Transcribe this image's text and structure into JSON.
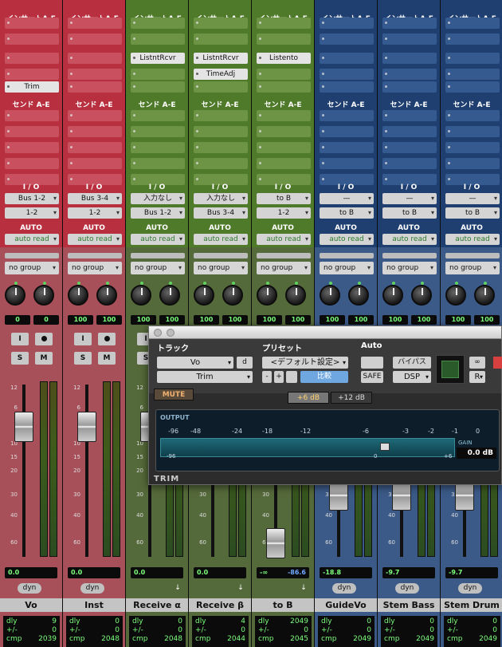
{
  "sections": {
    "insert": "インサートA-E",
    "send": "センド A-E",
    "io": "I / O",
    "auto": "AUTO"
  },
  "strips": [
    {
      "name": "Vo",
      "color": "red",
      "inserts": [
        "",
        "",
        "",
        "",
        "Trim"
      ],
      "io_in": "Bus 1-2",
      "io_out": "1-2",
      "auto": "auto read",
      "group": "no group",
      "pan_l": "0",
      "pan_r": "0",
      "volume": "0.0",
      "peak": "",
      "dyn": "dyn",
      "dly_label": "dly",
      "dly": "9",
      "pm_label": "+/-",
      "pm": "0",
      "cmp_label": "cmp",
      "cmp": "2039"
    },
    {
      "name": "Inst",
      "color": "red",
      "inserts": [
        "",
        "",
        "",
        "",
        ""
      ],
      "io_in": "Bus 3-4",
      "io_out": "1-2",
      "auto": "auto read",
      "group": "no group",
      "pan_l": "100",
      "pan_r": "100",
      "volume": "0.0",
      "peak": "",
      "dyn": "dyn",
      "dly_label": "dly",
      "dly": "0",
      "pm_label": "+/-",
      "pm": "0",
      "cmp_label": "cmp",
      "cmp": "2048"
    },
    {
      "name": "Receive α",
      "color": "green",
      "inserts": [
        "",
        "",
        "ListntRcvr",
        "",
        ""
      ],
      "io_in": "入力なし",
      "io_out": "Bus 1-2",
      "auto": "auto read",
      "group": "no group",
      "pan_l": "100",
      "pan_r": "100",
      "volume": "0.0",
      "peak": "",
      "dyn": "",
      "dly_label": "dly",
      "dly": "0",
      "pm_label": "+/-",
      "pm": "0",
      "cmp_label": "cmp",
      "cmp": "2048"
    },
    {
      "name": "Receive β",
      "color": "green",
      "inserts": [
        "",
        "",
        "ListntRcvr",
        "TimeAdj",
        ""
      ],
      "io_in": "入力なし",
      "io_out": "Bus 3-4",
      "auto": "auto read",
      "group": "no group",
      "pan_l": "100",
      "pan_r": "100",
      "volume": "0.0",
      "peak": "",
      "dyn": "",
      "dly_label": "dly",
      "dly": "4",
      "pm_label": "+/-",
      "pm": "0",
      "cmp_label": "cmp",
      "cmp": "2044"
    },
    {
      "name": "to B",
      "color": "green",
      "inserts": [
        "",
        "",
        "Listento",
        "",
        ""
      ],
      "io_in": "to B",
      "io_out": "1-2",
      "auto": "auto read",
      "group": "no group",
      "pan_l": "100",
      "pan_r": "100",
      "volume": "-∞",
      "peak": "-86.6",
      "dyn": "",
      "dly_label": "dly",
      "dly": "2049",
      "pm_label": "+/-",
      "pm": "0",
      "cmp_label": "cmp",
      "cmp": "2045"
    },
    {
      "name": "GuideVo",
      "color": "blue",
      "inserts": [
        "",
        "",
        "",
        "",
        ""
      ],
      "io_in": "—",
      "io_out": "to B",
      "auto": "auto read",
      "group": "no group",
      "pan_l": "100",
      "pan_r": "100",
      "volume": "-18.8",
      "peak": "",
      "dyn": "dyn",
      "dly_label": "dly",
      "dly": "0",
      "pm_label": "+/-",
      "pm": "0",
      "cmp_label": "cmp",
      "cmp": "2049"
    },
    {
      "name": "Stem Bass",
      "color": "blue",
      "inserts": [
        "",
        "",
        "",
        "",
        ""
      ],
      "io_in": "—",
      "io_out": "to B",
      "auto": "auto read",
      "group": "no group",
      "pan_l": "100",
      "pan_r": "100",
      "volume": "-9.7",
      "peak": "",
      "dyn": "dyn",
      "dly_label": "dly",
      "dly": "0",
      "pm_label": "+/-",
      "pm": "0",
      "cmp_label": "cmp",
      "cmp": "2049"
    },
    {
      "name": "Stem Drum",
      "color": "blue",
      "inserts": [
        "",
        "",
        "",
        "",
        ""
      ],
      "io_in": "—",
      "io_out": "to B",
      "auto": "auto read",
      "group": "no group",
      "pan_l": "100",
      "pan_r": "100",
      "volume": "-9.7",
      "peak": "",
      "dyn": "dyn",
      "dly_label": "dly",
      "dly": "0",
      "pm_label": "+/-",
      "pm": "0",
      "cmp_label": "cmp",
      "cmp": "2049"
    }
  ],
  "buttons": {
    "input": "I",
    "solo": "S",
    "mute": "M"
  },
  "scale": [
    "12",
    "6",
    "0",
    "5",
    "10",
    "15",
    "20",
    "30",
    "40",
    "60"
  ],
  "plugin": {
    "track_label": "トラック",
    "preset_label": "プリセット",
    "auto_label": "Auto",
    "track": "Vo",
    "track_suffix": "d",
    "insert": "Trim",
    "preset": "<デフォルト設定>",
    "minus": "-",
    "plus": "+",
    "compare": "比較",
    "safe": "SAFE",
    "bypass": "バイパス",
    "dsp": "DSP",
    "r": "R",
    "mute": "MUTE",
    "db6": "+6 dB",
    "db12": "+12 dB",
    "output": "OUTPUT",
    "ticks_top": [
      "-96",
      "-48",
      "-24",
      "-18",
      "-12",
      "-6",
      "-3",
      "-2",
      "-1",
      "0"
    ],
    "ticks_bottom": [
      "-96",
      "0",
      "+6"
    ],
    "gain_label": "GAIN",
    "gain": "0.0 dB",
    "name": "TRIM"
  }
}
